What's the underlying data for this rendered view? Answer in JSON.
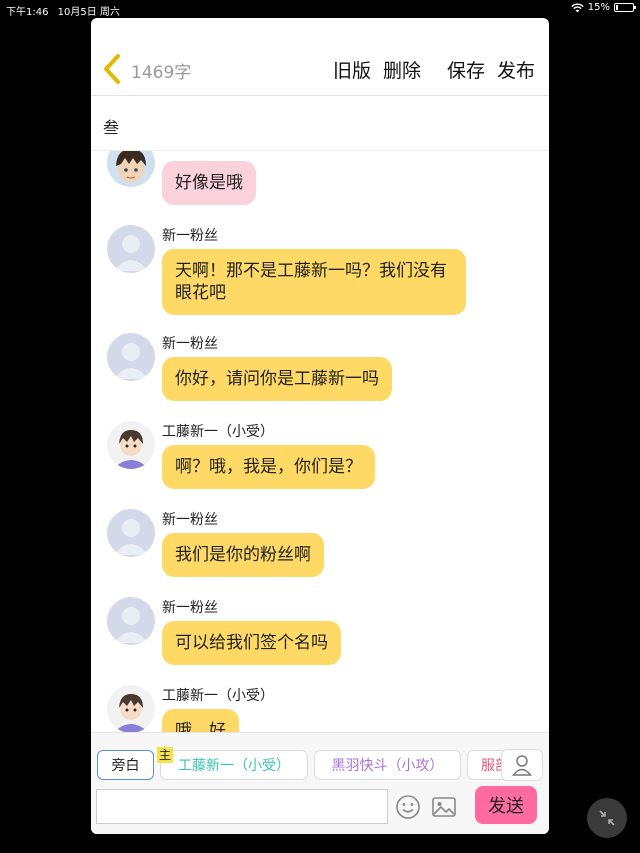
{
  "status_bar": {
    "time": "下午1:46",
    "date": "10月5日 周六",
    "battery": "15%",
    "battery_level": 0.15
  },
  "header": {
    "word_count": "1469字",
    "actions": [
      "旧版",
      "删除",
      "保存",
      "发布"
    ]
  },
  "chapter_title": "叁",
  "messages": [
    {
      "avatar": "anime-boy-avatar",
      "sender": "",
      "text": "好像是哦",
      "bubble_color": "#fbd1dc"
    },
    {
      "avatar": "default-avatar",
      "sender": "新一粉丝",
      "text": "天啊！那不是工藤新一吗？我们没有眼花吧",
      "bubble_color": "#ffd966"
    },
    {
      "avatar": "default-avatar",
      "sender": "新一粉丝",
      "text": "你好，请问你是工藤新一吗",
      "bubble_color": "#ffd966"
    },
    {
      "avatar": "shinichi-avatar",
      "sender": "工藤新一（小受）",
      "text": "啊？哦，我是，你们是？",
      "bubble_color": "#ffd966"
    },
    {
      "avatar": "default-avatar",
      "sender": "新一粉丝",
      "text": "我们是你的粉丝啊",
      "bubble_color": "#ffd966"
    },
    {
      "avatar": "default-avatar",
      "sender": "新一粉丝",
      "text": "可以给我们签个名吗",
      "bubble_color": "#ffd966"
    },
    {
      "avatar": "shinichi-avatar",
      "sender": "工藤新一（小受）",
      "text": "哦，好",
      "bubble_color": "#ffd966"
    }
  ],
  "roles": {
    "narrator": "旁白",
    "main_badge": "主",
    "items": [
      "工藤新一（小受）",
      "黑羽快斗（小攻）",
      "服部"
    ]
  },
  "composer": {
    "placeholder": "",
    "send_label": "发送"
  },
  "colors": {
    "accent": "#ffd966",
    "send": "#ff6b9f",
    "back_chevron": "#e6b800"
  }
}
